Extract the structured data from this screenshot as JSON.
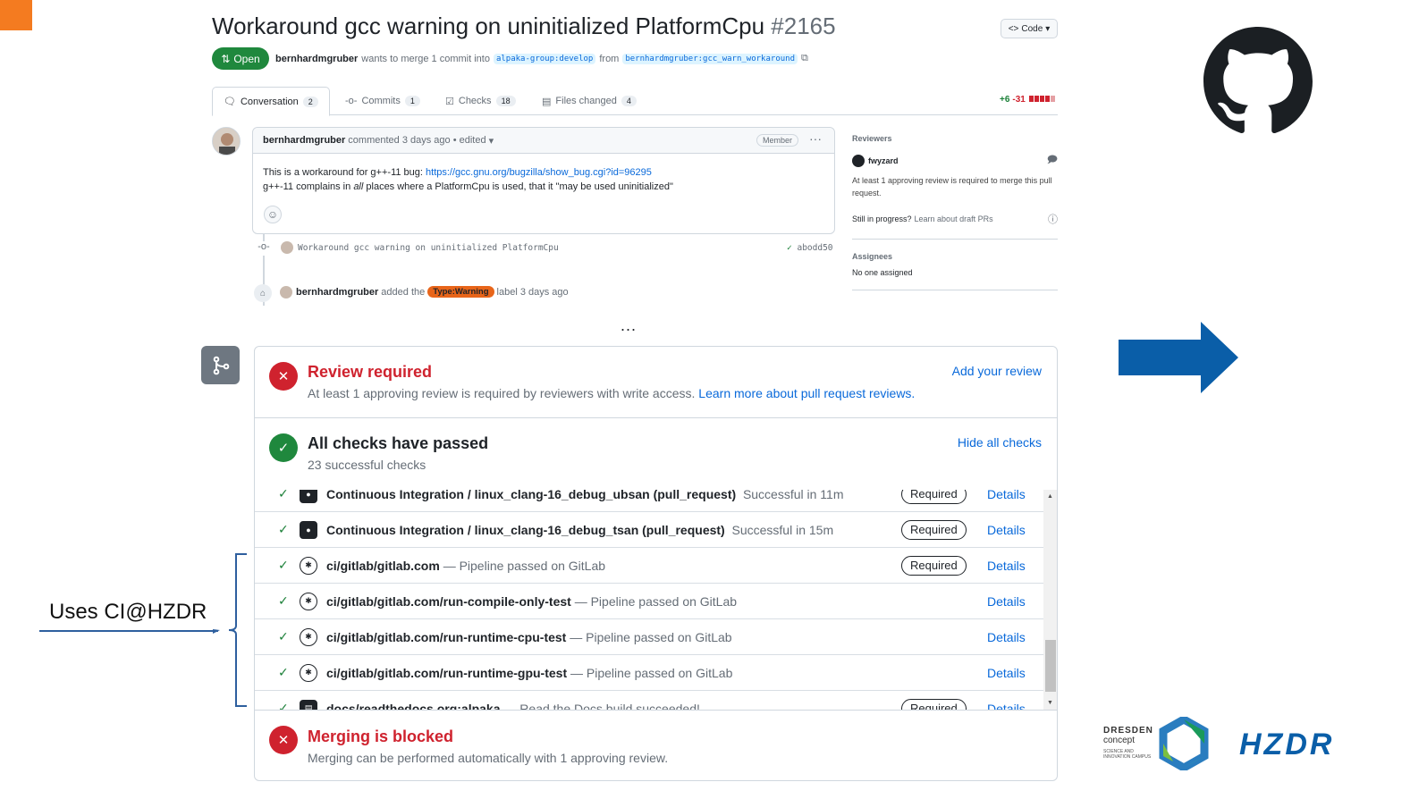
{
  "pr": {
    "title": "Workaround gcc warning on uninitialized PlatformCpu",
    "number": "#2165",
    "code_label": "Code",
    "state": "Open",
    "author": "bernhardmgruber",
    "merge_text": "wants to merge 1 commit into",
    "base_branch": "alpaka-group:develop",
    "from_text": "from",
    "head_branch": "bernhardmgruber:gcc_warn_workaround"
  },
  "tabs": [
    {
      "label": "Conversation",
      "count": "2"
    },
    {
      "label": "Commits",
      "count": "1"
    },
    {
      "label": "Checks",
      "count": "18"
    },
    {
      "label": "Files changed",
      "count": "4"
    }
  ],
  "diffstat": {
    "added": "+6",
    "removed": "-31"
  },
  "comment": {
    "author": "bernhardmgruber",
    "meta": "commented 3 days ago • edited",
    "badge": "Member",
    "line1_text": "This is a workaround for g++-11 bug: ",
    "line1_link": "https://gcc.gnu.org/bugzilla/show_bug.cgi?id=96295",
    "line2_a": "g++-11 complains in ",
    "line2_em": "all",
    "line2_b": " places where a PlatformCpu is used, that it \"may be used uninitialized\""
  },
  "timeline": {
    "commit_msg": "Workaround gcc warning on uninitialized PlatformCpu",
    "commit_sha": "abodd50",
    "label_author": "bernhardmgruber",
    "label_pre": "added the",
    "label_name": "Type:Warning",
    "label_post": "label 3 days ago",
    "ellipsis": "..."
  },
  "sidebar": {
    "reviewers_heading": "Reviewers",
    "reviewer": "fwyzard",
    "review_note": "At least 1 approving review is required to merge this pull request.",
    "draft_q": "Still in progress?",
    "draft_link": "Learn about draft PRs",
    "assignees_heading": "Assignees",
    "assignees_value": "No one assigned"
  },
  "merge_box": {
    "review_title": "Review required",
    "review_sub": "At least 1 approving review is required by reviewers with write access.",
    "review_sub_link": "Learn more about pull request reviews.",
    "review_action": "Add your review",
    "checks_title": "All checks have passed",
    "checks_sub": "23 successful checks",
    "checks_action": "Hide all checks",
    "blocked_title": "Merging is blocked",
    "blocked_sub": "Merging can be performed automatically with 1 approving review."
  },
  "checks": [
    {
      "name": "Continuous Integration / linux_clang-16_debug_ubsan (pull_request)",
      "status": "Successful in 11m",
      "required": "Required",
      "details": "Details"
    },
    {
      "name": "Continuous Integration / linux_clang-16_debug_tsan (pull_request)",
      "status": "Successful in 15m",
      "required": "Required",
      "details": "Details"
    },
    {
      "name": "ci/gitlab/gitlab.com",
      "status": "— Pipeline passed on GitLab",
      "required": "Required",
      "details": "Details"
    },
    {
      "name": "ci/gitlab/gitlab.com/run-compile-only-test",
      "status": "— Pipeline passed on GitLab",
      "required": "",
      "details": "Details"
    },
    {
      "name": "ci/gitlab/gitlab.com/run-runtime-cpu-test",
      "status": "— Pipeline passed on GitLab",
      "required": "",
      "details": "Details"
    },
    {
      "name": "ci/gitlab/gitlab.com/run-runtime-gpu-test",
      "status": "— Pipeline passed on GitLab",
      "required": "",
      "details": "Details"
    },
    {
      "name": "docs/readthedocs.org:alpaka",
      "status": "— Read the Docs build succeeded!",
      "required": "Required",
      "details": "Details"
    }
  ],
  "annotation": {
    "text": "Uses CI@HZDR"
  },
  "logos": {
    "dresden_line1": "DRESDEN",
    "dresden_line2": "concept",
    "dresden_small": "SCIENCE AND INNOVATION CAMPUS",
    "hzdr": "HZDR"
  },
  "colors": {
    "accent_orange": "#f47b20",
    "open_green": "#1f883d",
    "error_red": "#cf222e",
    "link_blue": "#0969da",
    "arrow_blue": "#0a5ea8"
  }
}
